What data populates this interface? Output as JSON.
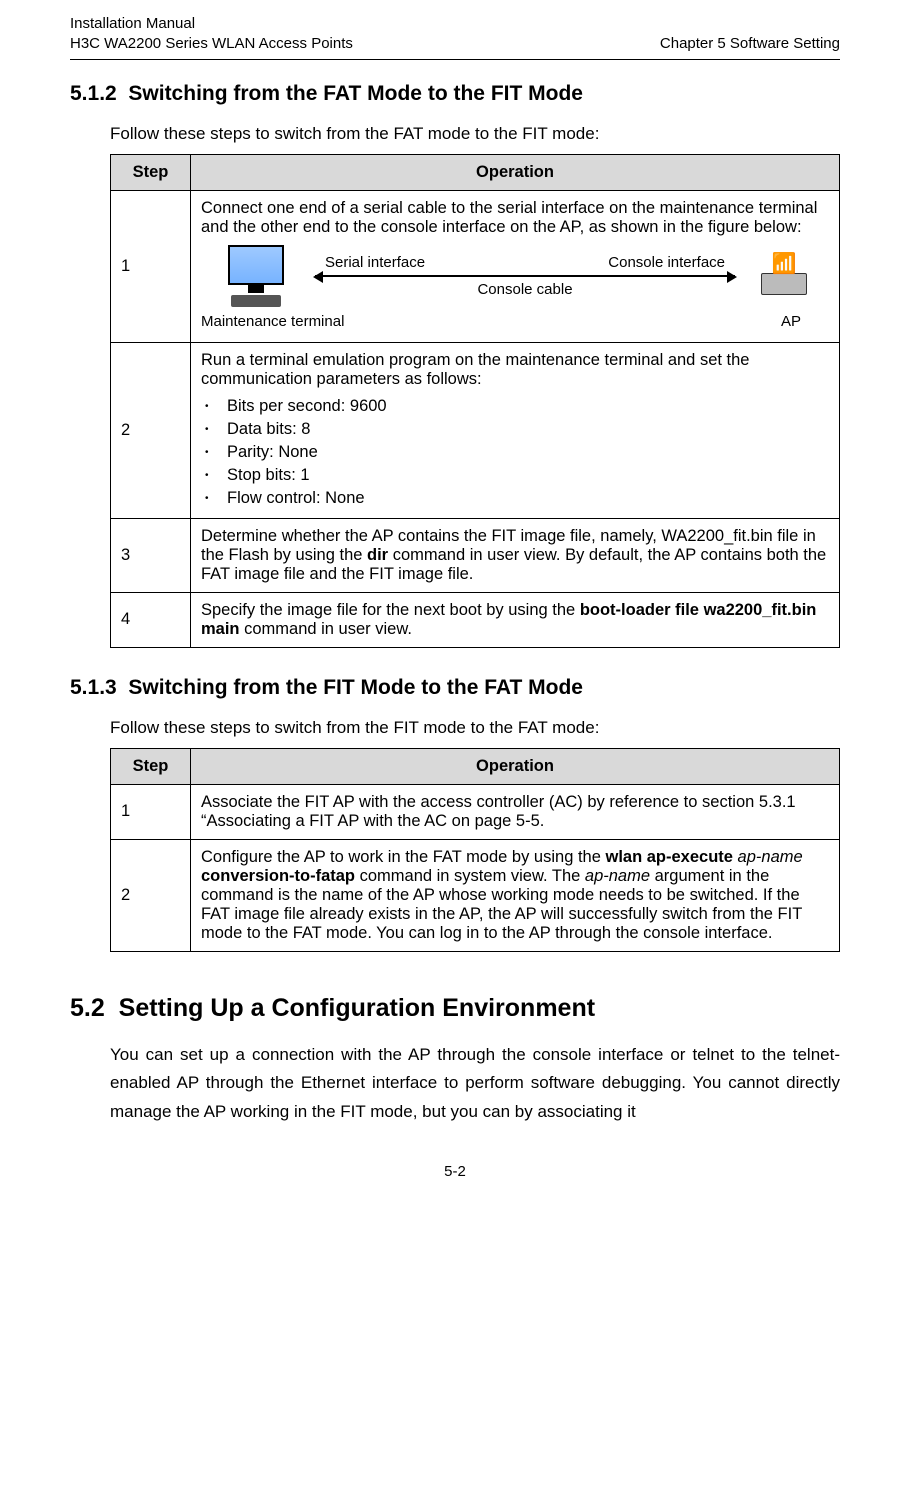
{
  "header": {
    "left_line1": "Installation Manual",
    "left_line2": "H3C WA2200 Series WLAN Access Points",
    "right": "Chapter 5  Software Setting"
  },
  "sections": {
    "s512": {
      "number": "5.1.2",
      "title": "Switching from the FAT Mode to the FIT Mode",
      "intro": "Follow these steps to switch from the FAT mode to the FIT mode:"
    },
    "s513": {
      "number": "5.1.3",
      "title": "Switching from the FIT Mode to the FAT Mode",
      "intro": "Follow these steps to switch from the FIT mode to the FAT mode:"
    },
    "s52": {
      "number": "5.2",
      "title": "Setting Up a Configuration Environment",
      "para": "You can set up a connection with the AP through the console interface or telnet to the telnet-enabled AP through the Ethernet interface to perform software debugging. You cannot directly manage the AP working in the FIT mode, but you can by associating it"
    }
  },
  "table_headers": {
    "step": "Step",
    "operation": "Operation"
  },
  "table1_rows": {
    "r1": {
      "no": "1",
      "lead": "Connect one end of a serial cable to the serial interface on the maintenance terminal and the other end to the console interface on the AP, as shown in the figure below:"
    },
    "r2": {
      "no": "2",
      "lead": "Run a terminal emulation program on the maintenance terminal and set the communication parameters as follows:",
      "p1": "Bits per second: 9600",
      "p2": "Data bits: 8",
      "p3": "Parity: None",
      "p4": "Stop bits: 1",
      "p5": "Flow control: None"
    },
    "r3": {
      "no": "3",
      "op_pre": "Determine whether the AP contains the FIT image file, namely, WA2200_fit.bin file in the Flash by using the ",
      "op_bold": "dir",
      "op_post": " command in user view. By default, the AP contains both the FAT image file and the FIT image file."
    },
    "r4": {
      "no": "4",
      "op_pre": "Specify the image file for the next boot by using the ",
      "op_bold": "boot-loader file wa2200_fit.bin main",
      "op_post": " command in user view."
    }
  },
  "table2_rows": {
    "r1": {
      "no": "1",
      "op": "Associate the FIT AP with the access controller (AC) by reference to section 5.3.1  “Associating a FIT AP with the AC on page 5-5."
    },
    "r2": {
      "no": "2",
      "op_a": "Configure the AP to work in the FAT mode by using the ",
      "op_b_bold": "wlan ap-execute",
      "op_c_space": " ",
      "op_d_italic": "ap-name",
      "op_e_space": " ",
      "op_f_bold": "conversion-to-fatap",
      "op_g": " command in system view. The ",
      "op_h_italic": "ap-name",
      "op_i": " argument in the command is the name of the AP whose working mode needs to be switched. If the FAT image file already exists in the AP, the AP will successfully switch from the FIT mode to the FAT mode. You can log in to the AP through the console interface."
    }
  },
  "diagram": {
    "serial_if": "Serial interface",
    "console_if": "Console interface",
    "cable": "Console cable",
    "term_caption": "Maintenance terminal",
    "ap_caption": "AP"
  },
  "footer": {
    "page_num": "5-2"
  }
}
